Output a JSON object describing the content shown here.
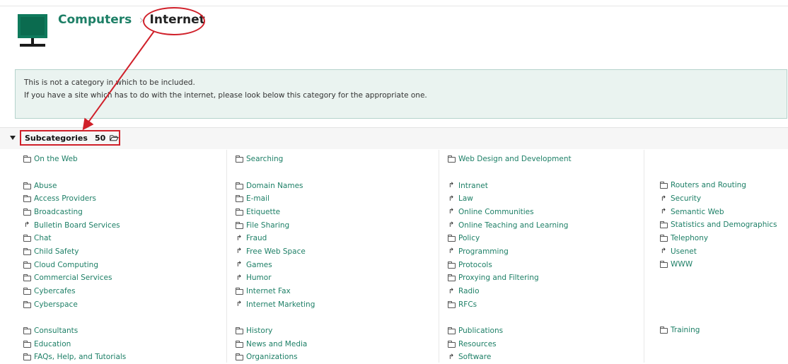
{
  "breadcrumb": {
    "parent": "Computers",
    "separator": "›",
    "current": "Internet"
  },
  "notice": {
    "line1": "This is not a category in which to be included.",
    "line2": "If you have a site which has to do with the internet, please look below this category for the appropriate one."
  },
  "subcategories": {
    "label": "Subcategories",
    "count": "50"
  },
  "columns": [
    [
      {
        "label": "On the Web",
        "type": "folder"
      },
      null,
      {
        "label": "Abuse",
        "type": "folder"
      },
      {
        "label": "Access Providers",
        "type": "folder"
      },
      {
        "label": "Broadcasting",
        "type": "folder"
      },
      {
        "label": "Bulletin Board Services",
        "type": "link"
      },
      {
        "label": "Chat",
        "type": "folder"
      },
      {
        "label": "Child Safety",
        "type": "folder"
      },
      {
        "label": "Cloud Computing",
        "type": "folder"
      },
      {
        "label": "Commercial Services",
        "type": "folder"
      },
      {
        "label": "Cybercafes",
        "type": "folder"
      },
      {
        "label": "Cyberspace",
        "type": "folder"
      },
      null,
      {
        "label": "Consultants",
        "type": "folder"
      },
      {
        "label": "Education",
        "type": "folder"
      },
      {
        "label": "FAQs, Help, and Tutorials",
        "type": "folder"
      }
    ],
    [
      {
        "label": "Searching",
        "type": "folder"
      },
      null,
      {
        "label": "Domain Names",
        "type": "folder"
      },
      {
        "label": "E-mail",
        "type": "folder"
      },
      {
        "label": "Etiquette",
        "type": "folder"
      },
      {
        "label": "File Sharing",
        "type": "folder"
      },
      {
        "label": "Fraud",
        "type": "link"
      },
      {
        "label": "Free Web Space",
        "type": "link"
      },
      {
        "label": "Games",
        "type": "link"
      },
      {
        "label": "Humor",
        "type": "link"
      },
      {
        "label": "Internet Fax",
        "type": "folder"
      },
      {
        "label": "Internet Marketing",
        "type": "link"
      },
      null,
      {
        "label": "History",
        "type": "folder"
      },
      {
        "label": "News and Media",
        "type": "folder"
      },
      {
        "label": "Organizations",
        "type": "folder"
      }
    ],
    [
      {
        "label": "Web Design and Development",
        "type": "folder"
      },
      null,
      {
        "label": "Intranet",
        "type": "link"
      },
      {
        "label": "Law",
        "type": "link"
      },
      {
        "label": "Online Communities",
        "type": "link"
      },
      {
        "label": "Online Teaching and Learning",
        "type": "link"
      },
      {
        "label": "Policy",
        "type": "folder"
      },
      {
        "label": "Programming",
        "type": "link"
      },
      {
        "label": "Protocols",
        "type": "folder"
      },
      {
        "label": "Proxying and Filtering",
        "type": "folder"
      },
      {
        "label": "Radio",
        "type": "link"
      },
      {
        "label": "RFCs",
        "type": "folder"
      },
      null,
      {
        "label": "Publications",
        "type": "folder"
      },
      {
        "label": "Resources",
        "type": "folder"
      },
      {
        "label": "Software",
        "type": "link"
      }
    ],
    [
      null,
      null,
      {
        "label": "Routers and Routing",
        "type": "folder"
      },
      {
        "label": "Security",
        "type": "link"
      },
      {
        "label": "Semantic Web",
        "type": "link"
      },
      {
        "label": "Statistics and Demographics",
        "type": "folder"
      },
      {
        "label": "Telephony",
        "type": "folder"
      },
      {
        "label": "Usenet",
        "type": "link"
      },
      {
        "label": "WWW",
        "type": "folder"
      },
      null,
      null,
      null,
      null,
      {
        "label": "Training",
        "type": "folder"
      }
    ]
  ],
  "colors": {
    "link": "#1d7f66",
    "annotation": "#d0202a",
    "notice_bg": "#eaf3f0"
  }
}
